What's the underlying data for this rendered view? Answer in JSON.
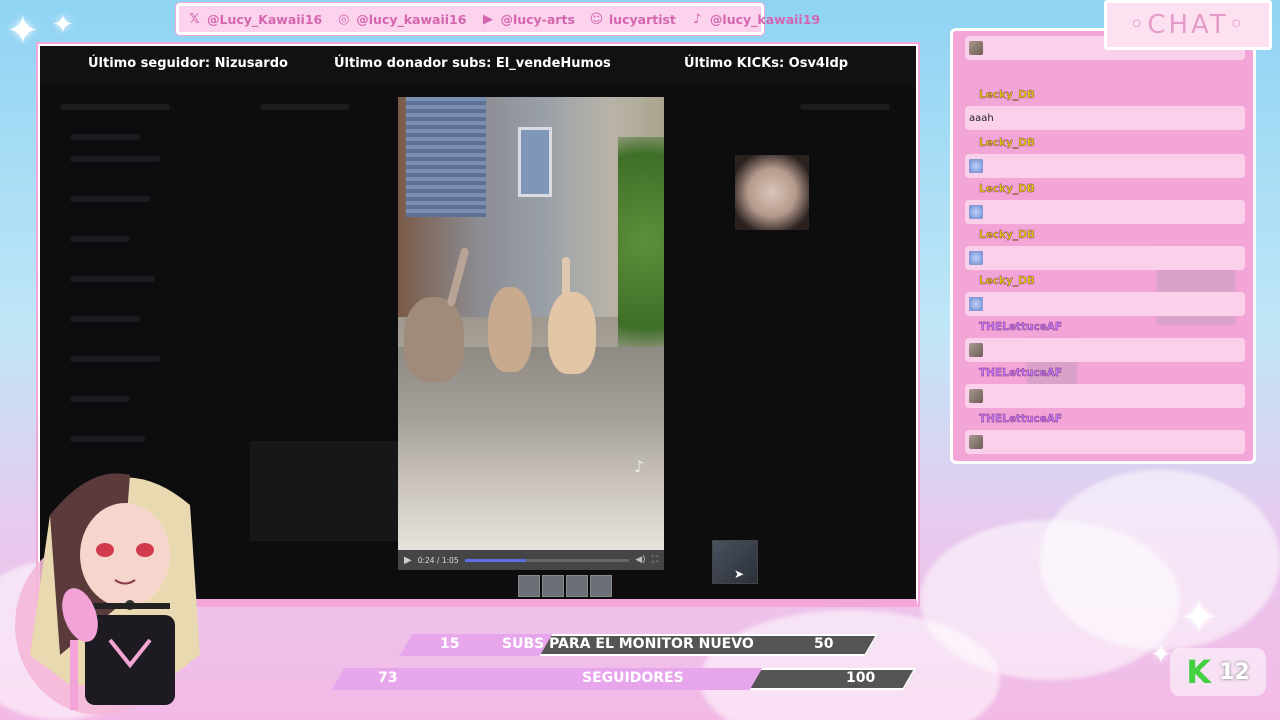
{
  "social": [
    {
      "icon": "x-icon",
      "glyph": "𝕏",
      "label": "@Lucy_Kawaii16"
    },
    {
      "icon": "instagram-icon",
      "glyph": "◎",
      "label": "@lucy_kawaii16"
    },
    {
      "icon": "youtube-icon",
      "glyph": "▶",
      "label": "@lucy-arts"
    },
    {
      "icon": "discord-icon",
      "glyph": "☺",
      "label": "lucyartist"
    },
    {
      "icon": "tiktok-icon",
      "glyph": "♪",
      "label": "@lucy_kawaii19"
    }
  ],
  "stats": {
    "last_follower": "Último seguidor: Nizusardo",
    "last_sub_donor": "Último donador subs: El_vendeHumos",
    "last_kicks": "Último KICKs: Osv4ldp"
  },
  "video": {
    "time": "0:24 / 1:05",
    "progress": 0.37
  },
  "chat": {
    "header": "◦CHAT◦",
    "messages": [
      {
        "user": "",
        "text": "",
        "emote": "hamster",
        "color": "yellow"
      },
      {
        "user": "Lecky_DB",
        "text": "aaah",
        "emote": "",
        "color": "yellow"
      },
      {
        "user": "Lecky_DB",
        "text": "",
        "emote": "blue",
        "color": "yellow"
      },
      {
        "user": "Lecky_DB",
        "text": "",
        "emote": "blue",
        "color": "yellow"
      },
      {
        "user": "Lecky_DB",
        "text": "",
        "emote": "blue",
        "color": "yellow"
      },
      {
        "user": "Lecky_DB",
        "text": "",
        "emote": "blue",
        "color": "yellow"
      },
      {
        "user": "THELettuceAF",
        "text": "",
        "emote": "hamster",
        "color": "purple"
      },
      {
        "user": "THELettuceAF",
        "text": "",
        "emote": "hamster",
        "color": "purple"
      },
      {
        "user": "THELettuceAF",
        "text": "",
        "emote": "hamster",
        "color": "purple"
      }
    ]
  },
  "goals": {
    "subs": {
      "current": "15",
      "label": "SUBS PARA EL MONITOR NUEVO",
      "target": "50",
      "progress": 0.3
    },
    "followers": {
      "current": "73",
      "label": "SEGUIDORES",
      "target": "100",
      "progress": 0.73
    }
  },
  "kick": {
    "letter": "K",
    "count": "12"
  },
  "colors": {
    "pink": "#f3a5d8",
    "light_pink": "#fbd0ea",
    "kick_green": "#43d142",
    "goal_fill": "#e7a6ec",
    "goal_empty": "#555555"
  }
}
